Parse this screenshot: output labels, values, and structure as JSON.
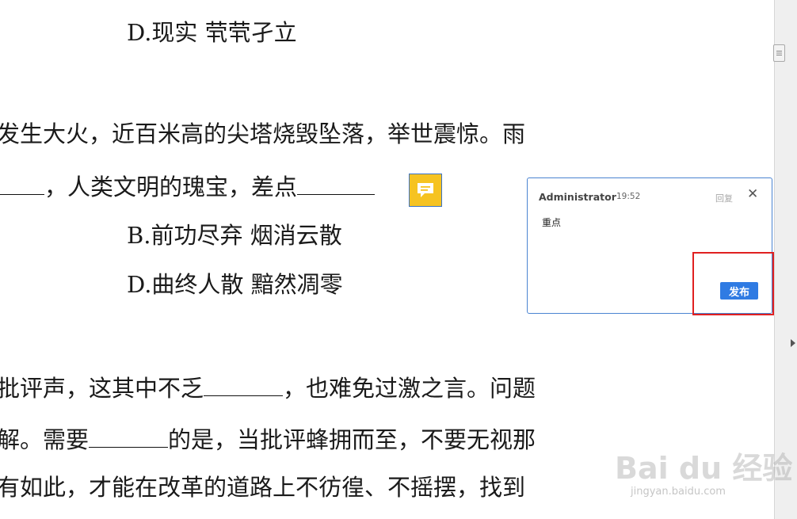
{
  "document": {
    "line1": "D.现实   茕茕孑立",
    "line2": "发生大火，近百米高的尖塔烧毁坠落，举世震惊。雨",
    "line3_after_blank": "，人类文明的瑰宝，差点",
    "line4": "B.前功尽弃   烟消云散",
    "line5": "D.曲终人散   黯然凋零",
    "line6_before_blank": "批评声，这其中不乏",
    "line6_after_blank": "，也难免过激之言。问题",
    "line7_before_blank": "解。需要",
    "line7_after_blank": "的是，当批评蜂拥而至，不要无视那",
    "line8": "有如此，才能在改革的道路上不彷徨、不摇摆，找到"
  },
  "comment": {
    "author": "Administrator",
    "time": "19:52",
    "reply_label": "回复",
    "close_label": "✕",
    "body": "重点",
    "publish_label": "发布"
  },
  "watermark": {
    "logo": "Bai du 经验",
    "url": "jingyan.baidu.com"
  },
  "icons": {
    "comment_marker": "comment-bubble-icon",
    "scroll_arrow": "triangle-right-icon"
  },
  "colors": {
    "marker_fill": "#f6c321",
    "card_border": "#4a84d1",
    "publish_button": "#2f7be3",
    "highlight": "#e02020"
  }
}
